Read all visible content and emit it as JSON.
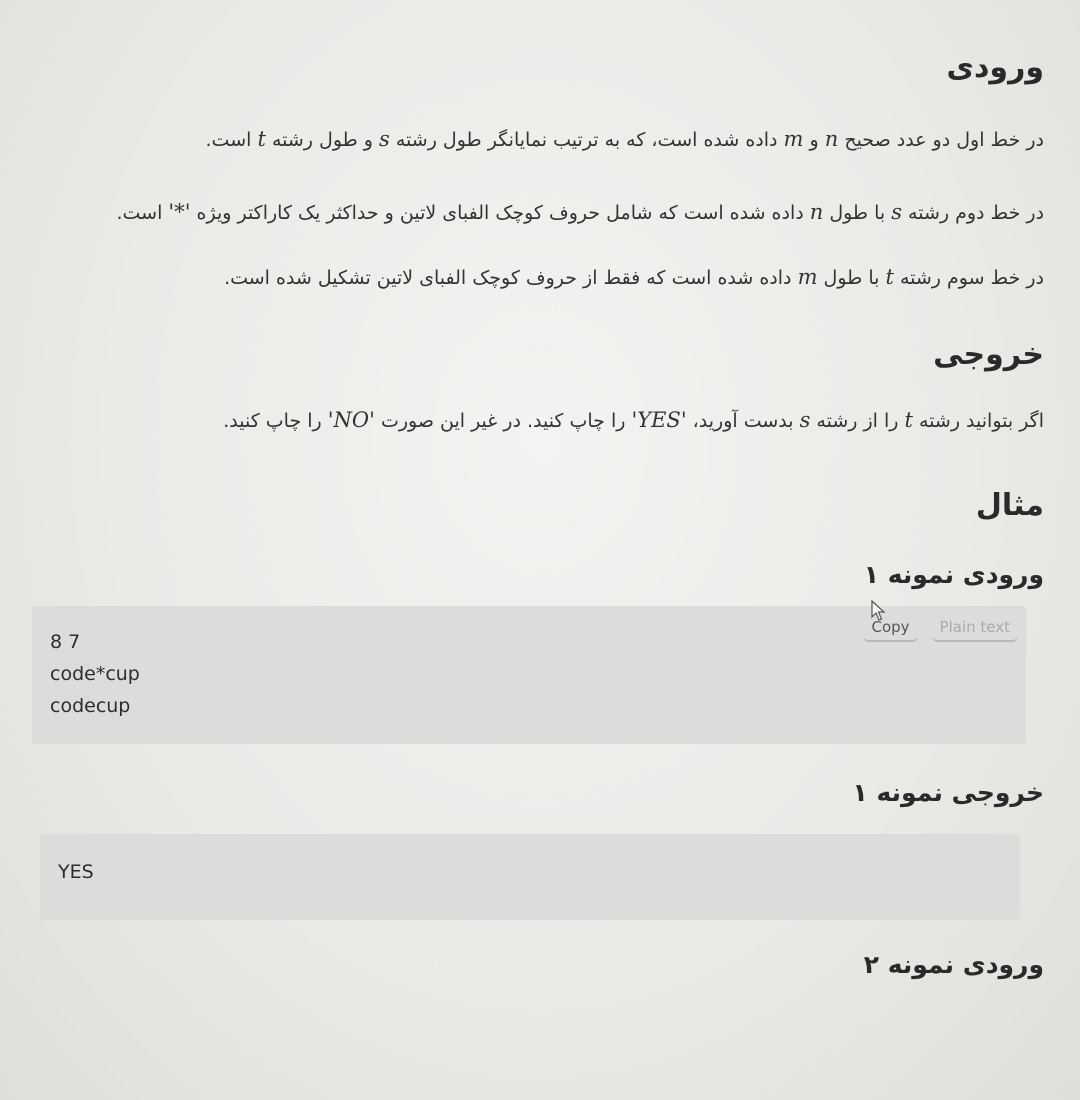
{
  "input_section": {
    "title": "ورودی",
    "line1": {
      "a": "در خط اول دو عدد صحیح",
      "n": "n",
      "b": "و",
      "m": "m",
      "c": "داده شده است، که به ترتیب نمایانگر طول رشته",
      "s": "s",
      "d": "و طول رشته",
      "t": "t",
      "e": "است."
    },
    "line2": {
      "a": "در خط دوم رشته",
      "s": "s",
      "b": "با طول",
      "n": "n",
      "c": "داده شده است که شامل حروف کوچک الفبای لاتین و حداکثر یک کاراکتر ویژه",
      "star": "'*'",
      "d": "است."
    },
    "line3": {
      "a": "در خط سوم رشته",
      "t": "t",
      "b": "با طول",
      "m": "m",
      "c": "داده شده است که فقط از حروف کوچک الفبای لاتین تشکیل شده است."
    }
  },
  "output_section": {
    "title": "خروجی",
    "line": {
      "a": "اگر بتوانید رشته",
      "t": "t",
      "b": "را از رشته",
      "s": "s",
      "c": "بدست آورید،",
      "yes": "'YES'",
      "d": "را چاپ کنید. در غیر این صورت",
      "no": "'NO'",
      "e": "را چاپ کنید."
    }
  },
  "example_section": {
    "title": "مثال",
    "sample_input_1_title": "ورودی نمونه ۱",
    "sample_input_1": "8 7\ncode*cup\ncodecup",
    "copy_label": "Copy",
    "plain_text_label": "Plain text",
    "sample_output_1_title": "خروجی نمونه ۱",
    "sample_output_1": "YES",
    "sample_input_2_title": "ورودی نمونه ۲"
  }
}
